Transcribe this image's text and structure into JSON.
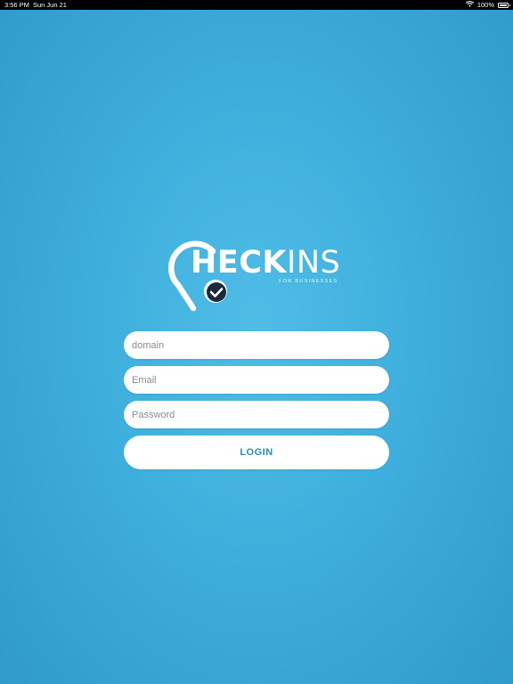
{
  "status_bar": {
    "time": "3:56 PM",
    "date": "Sun Jun 21",
    "battery": "100%",
    "battery_level": 1.0,
    "icons": [
      "wifi-icon",
      "battery-icon"
    ]
  },
  "logo": {
    "text_bold": "HECK",
    "text_thin": "INS",
    "tagline": "FOR BUSINESSES",
    "icon": "location-pin-check-icon"
  },
  "form": {
    "domain_placeholder": "domain",
    "email_placeholder": "Email",
    "password_placeholder": "Password",
    "login_label": "LOGIN"
  },
  "colors": {
    "background": "#3eaedc",
    "accent": "#2a8ec0",
    "check_badge": "#1c2b3a",
    "field_bg": "#ffffff"
  }
}
